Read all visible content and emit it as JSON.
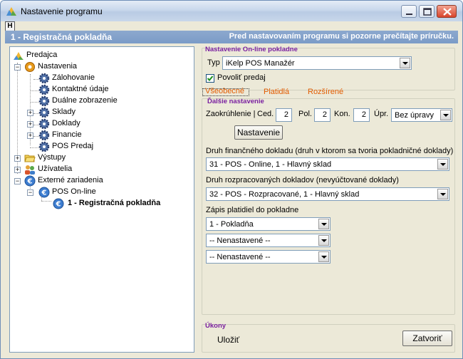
{
  "window": {
    "title": "Nastavenie programu",
    "h_button": "H"
  },
  "banner": {
    "left": "1 - Registračná pokladňa",
    "right": "Pred nastavovaním programu si pozorne prečítajte príručku."
  },
  "tree": {
    "items": [
      {
        "label": "Predajca",
        "icon": "store-icon"
      },
      {
        "label": "Nastavenia",
        "icon": "settings-gear-icon"
      },
      {
        "label": "Zálohovanie",
        "icon": "gear-icon"
      },
      {
        "label": "Kontaktné údaje",
        "icon": "gear-icon"
      },
      {
        "label": "Duálne zobrazenie",
        "icon": "gear-icon"
      },
      {
        "label": "Sklady",
        "icon": "gear-icon"
      },
      {
        "label": "Doklady",
        "icon": "gear-icon"
      },
      {
        "label": "Financie",
        "icon": "gear-icon"
      },
      {
        "label": "POS Predaj",
        "icon": "gear-icon"
      },
      {
        "label": "Výstupy",
        "icon": "folder-icon"
      },
      {
        "label": "Užívatelia",
        "icon": "users-icon"
      },
      {
        "label": "Externé zariadenia",
        "icon": "euro-icon"
      },
      {
        "label": "POS On-line",
        "icon": "euro-icon"
      },
      {
        "label": "1 - Registračná pokladňa",
        "icon": "euro-icon"
      }
    ]
  },
  "online": {
    "section_title": "Nastavenie On-line pokladne",
    "type_label": "Typ",
    "type_value": "iKelp POS Manažér",
    "allow_sale_label": "Povoliť predaj",
    "allow_sale_checked": true
  },
  "tabs": [
    "Všeobecné",
    "Platidlá",
    "Rozšírené"
  ],
  "more": {
    "section_title": "Ďalšie nastavenie",
    "rounding_label": "Zaokrúhlenie |",
    "ced_label": "Ced.",
    "ced_value": "2",
    "pol_label": "Pol.",
    "pol_value": "2",
    "kon_label": "Kon.",
    "kon_value": "2",
    "upr_label": "Úpr.",
    "upr_value": "Bez úpravy",
    "settings_button": "Nastavenie"
  },
  "financial_doc": {
    "label": "Druh finančného dokladu (druh v ktorom sa tvoria pokladničné doklady)",
    "value": "31 - POS - Online, 1 - Hlavný sklad"
  },
  "draft_doc": {
    "label": "Druh rozpracovaných dokladov (nevyúčtované doklady)",
    "value": "32 - POS - Rozpracované, 1 - Hlavný sklad"
  },
  "payments": {
    "label": "Zápis platidiel do pokladne",
    "values": [
      "1 - Pokladňa",
      "-- Nenastavené --",
      "-- Nenastavené --"
    ]
  },
  "actions": {
    "section_title": "Úkony",
    "save": "Uložiť",
    "close": "Zatvoriť"
  }
}
